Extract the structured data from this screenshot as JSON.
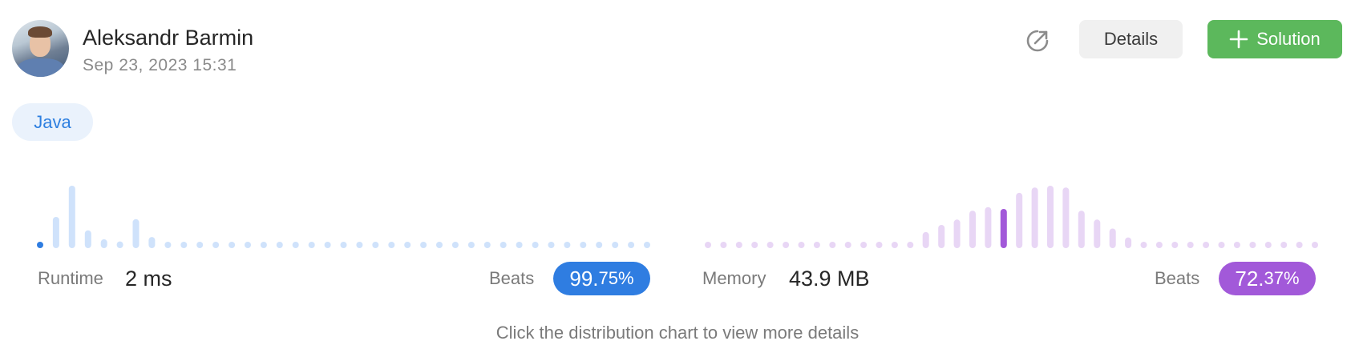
{
  "user": {
    "name": "Aleksandr Barmin",
    "timestamp": "Sep 23, 2023 15:31"
  },
  "actions": {
    "share_icon": "share-arrow-icon",
    "details_label": "Details",
    "solution_label": "Solution",
    "solution_icon": "plus-icon"
  },
  "language": "Java",
  "runtime": {
    "label": "Runtime",
    "value": "2 ms",
    "beats_label": "Beats",
    "beats_main": "99.",
    "beats_fraction": "75%",
    "color": "#2f7de1"
  },
  "memory": {
    "label": "Memory",
    "value": "43.9 MB",
    "beats_label": "Beats",
    "beats_main": "72.",
    "beats_fraction": "37%",
    "color": "#a259d9"
  },
  "hint": "Click the distribution chart to view more details",
  "chart_data": [
    {
      "type": "bar",
      "name": "runtime-distribution",
      "values": [
        1,
        14,
        28,
        8,
        4,
        3,
        13,
        5,
        1,
        1,
        1,
        1,
        1,
        1,
        1,
        1,
        1,
        1,
        1,
        1,
        1,
        1,
        1,
        1,
        1,
        1,
        1,
        1,
        1,
        1,
        1,
        1,
        1,
        1,
        1,
        1,
        1,
        1,
        1
      ],
      "highlight_index": 0,
      "bar_color": "#cfe2fb",
      "highlight_color": "#2f7de1"
    },
    {
      "type": "bar",
      "name": "memory-distribution",
      "values": [
        1,
        1,
        1,
        1,
        1,
        1,
        1,
        1,
        1,
        1,
        1,
        1,
        1,
        1,
        9,
        13,
        16,
        21,
        23,
        22,
        31,
        34,
        35,
        34,
        21,
        16,
        11,
        6,
        3,
        2,
        2,
        1,
        1,
        1,
        1,
        1,
        1,
        1,
        1,
        1
      ],
      "highlight_index": 19,
      "bar_color": "#e8d6f5",
      "highlight_color": "#a259d9"
    }
  ]
}
